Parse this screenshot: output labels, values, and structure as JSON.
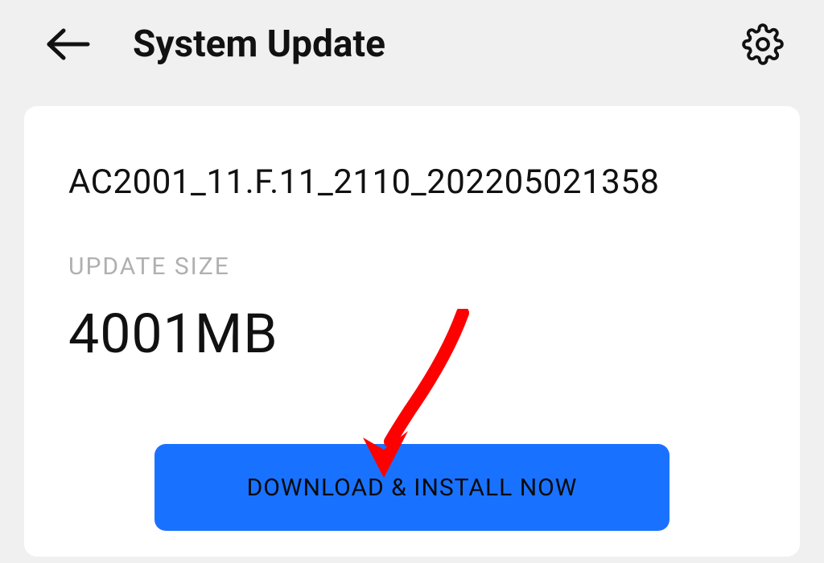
{
  "header": {
    "title": "System Update"
  },
  "update": {
    "version": "AC2001_11.F.11_2110_202205021358",
    "size_label": "UPDATE SIZE",
    "size_value": "4001MB",
    "download_button": "DOWNLOAD & INSTALL NOW"
  }
}
